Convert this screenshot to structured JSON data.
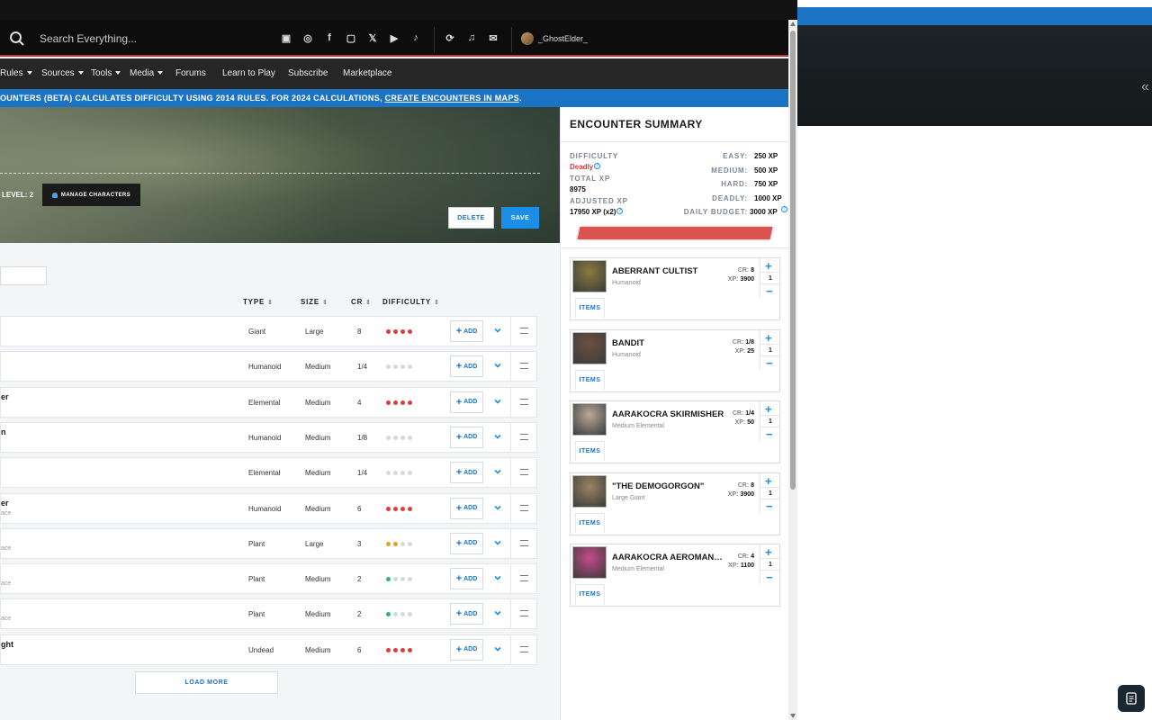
{
  "search": {
    "placeholder": "Search Everything..."
  },
  "header": {
    "social_icons": [
      "discord-icon",
      "instagram-icon",
      "facebook-icon",
      "twitch-icon",
      "x-icon",
      "youtube-icon",
      "tiktok-icon"
    ],
    "utility_icons": [
      "dice-icon",
      "bell-icon",
      "chat-icon"
    ],
    "username": "_GhostElder_"
  },
  "nav": {
    "items": [
      "Rules",
      "Sources",
      "Tools",
      "Media",
      "Forums",
      "Learn to Play",
      "Subscribe",
      "Marketplace"
    ]
  },
  "banner": {
    "text": "OUNTERS (BETA) CALCULATES DIFFICULTY USING 2014 RULES. FOR 2024 CALCULATIONS, ",
    "link": "CREATE ENCOUNTERS IN MAPS",
    "end": "."
  },
  "party": {
    "level_label": "LEVEL: 2",
    "manage_label": "MANAGE CHARACTERS",
    "delete_label": "DELETE",
    "save_label": "SAVE"
  },
  "table": {
    "headers": {
      "type": "TYPE",
      "size": "SIZE",
      "cr": "CR",
      "difficulty": "DIFFICULTY"
    },
    "add_label": "ADD",
    "rows": [
      {
        "name": "",
        "sub": "",
        "type": "Giant",
        "size": "Large",
        "cr": "8",
        "difficulty_level": 4,
        "difficulty_color": "#e03c3c"
      },
      {
        "name": "",
        "sub": "",
        "type": "Humanoid",
        "size": "Medium",
        "cr": "1/4",
        "difficulty_level": 0,
        "difficulty_color": "#d3d9df"
      },
      {
        "name": "er",
        "sub": "",
        "type": "Elemental",
        "size": "Medium",
        "cr": "4",
        "difficulty_level": 4,
        "difficulty_color": "#e03c3c"
      },
      {
        "name": "n",
        "sub": "",
        "type": "Humanoid",
        "size": "Medium",
        "cr": "1/8",
        "difficulty_level": 0,
        "difficulty_color": "#d3d9df"
      },
      {
        "name": "",
        "sub": "",
        "type": "Elemental",
        "size": "Medium",
        "cr": "1/4",
        "difficulty_level": 0,
        "difficulty_color": "#d3d9df"
      },
      {
        "name": "er",
        "sub": "ace",
        "type": "Humanoid",
        "size": "Medium",
        "cr": "6",
        "difficulty_level": 4,
        "difficulty_color": "#e03c3c"
      },
      {
        "name": "",
        "sub": "ace",
        "type": "Plant",
        "size": "Large",
        "cr": "3",
        "difficulty_level": 2,
        "difficulty_color": "#e8a317"
      },
      {
        "name": "",
        "sub": "ace",
        "type": "Plant",
        "size": "Medium",
        "cr": "2",
        "difficulty_level": 1,
        "difficulty_color": "#2bb39a"
      },
      {
        "name": "",
        "sub": "ace",
        "type": "Plant",
        "size": "Medium",
        "cr": "2",
        "difficulty_level": 1,
        "difficulty_color": "#2bb39a"
      },
      {
        "name": "ght",
        "sub": "",
        "type": "Undead",
        "size": "Medium",
        "cr": "6",
        "difficulty_level": 4,
        "difficulty_color": "#e03c3c"
      }
    ],
    "load_more": "LOAD MORE"
  },
  "summary": {
    "title": "ENCOUNTER SUMMARY",
    "difficulty_label": "DIFFICULTY",
    "difficulty_value": "Deadly",
    "total_xp_label": "TOTAL XP",
    "total_xp_value": "8975",
    "adjusted_xp_label": "ADJUSTED XP",
    "adjusted_xp_value": "17950 XP (x2)",
    "thresholds": [
      {
        "label": "EASY:",
        "value": "250 XP"
      },
      {
        "label": "MEDIUM:",
        "value": "500 XP"
      },
      {
        "label": "HARD:",
        "value": "750 XP"
      },
      {
        "label": "DEADLY:",
        "value": "1000 XP"
      },
      {
        "label": "DAILY BUDGET:",
        "value": "3000 XP"
      }
    ],
    "difficulty_bar_color": "#d9534f"
  },
  "encounter": {
    "items_label": "ITEMS",
    "cr_label": "CR:",
    "xp_label": "XP:",
    "monsters": [
      {
        "name": "ABERRANT CULTIST",
        "type": "Humanoid",
        "cr": "8",
        "xp": "3900",
        "qty": "1",
        "portrait_color": "#8a7a3c"
      },
      {
        "name": "BANDIT",
        "type": "Humanoid",
        "cr": "1/8",
        "xp": "25",
        "qty": "1",
        "portrait_color": "#6b5040"
      },
      {
        "name": "AARAKOCRA SKIRMISHER",
        "type": "Medium Elemental",
        "cr": "1/4",
        "xp": "50",
        "qty": "1",
        "portrait_color": "#b8a898"
      },
      {
        "name": "\"THE DEMOGORGON\"",
        "type": "Large Giant",
        "cr": "8",
        "xp": "3900",
        "qty": "1",
        "portrait_color": "#9a8462"
      },
      {
        "name": "AARAKOCRA AEROMANCER",
        "type": "Medium Elemental",
        "cr": "4",
        "xp": "1100",
        "qty": "1",
        "portrait_color": "#c44a8a"
      }
    ]
  }
}
